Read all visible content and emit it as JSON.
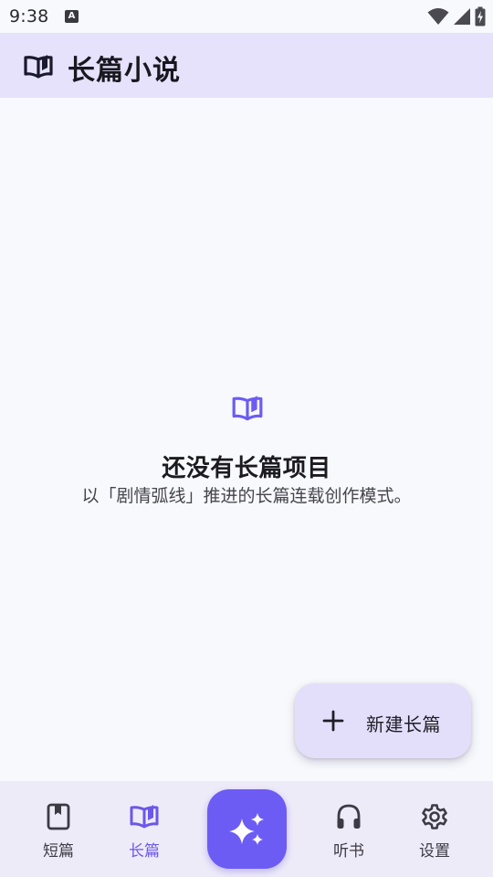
{
  "status_bar": {
    "time": "9:38",
    "notification_badge": "A",
    "icons": [
      "wifi-icon",
      "signal-icon",
      "battery-icon"
    ]
  },
  "app_bar": {
    "icon": "open-book-icon",
    "title": "长篇小说"
  },
  "empty_state": {
    "icon": "open-book-icon",
    "title": "还没有长篇项目",
    "subtitle": "以「剧情弧线」推进的长篇连载创作模式。"
  },
  "fab": {
    "icon": "plus-icon",
    "label": "新建长篇"
  },
  "bottom_nav": {
    "items": [
      {
        "id": "short",
        "label": "短篇",
        "icon": "bookmark-book-icon",
        "active": false
      },
      {
        "id": "long",
        "label": "长篇",
        "icon": "open-book-icon",
        "active": true
      },
      {
        "id": "ai",
        "label": "",
        "icon": "sparkles-icon",
        "active": false
      },
      {
        "id": "audiobook",
        "label": "听书",
        "icon": "headphones-icon",
        "active": false
      },
      {
        "id": "settings",
        "label": "设置",
        "icon": "gear-icon",
        "active": false
      }
    ]
  },
  "colors": {
    "accent": "#6c5cf4",
    "app_bar_bg": "#e6e2fb",
    "nav_bg": "#eeebf9",
    "active_label": "#6b57ea",
    "background": "#f8f9fc"
  }
}
